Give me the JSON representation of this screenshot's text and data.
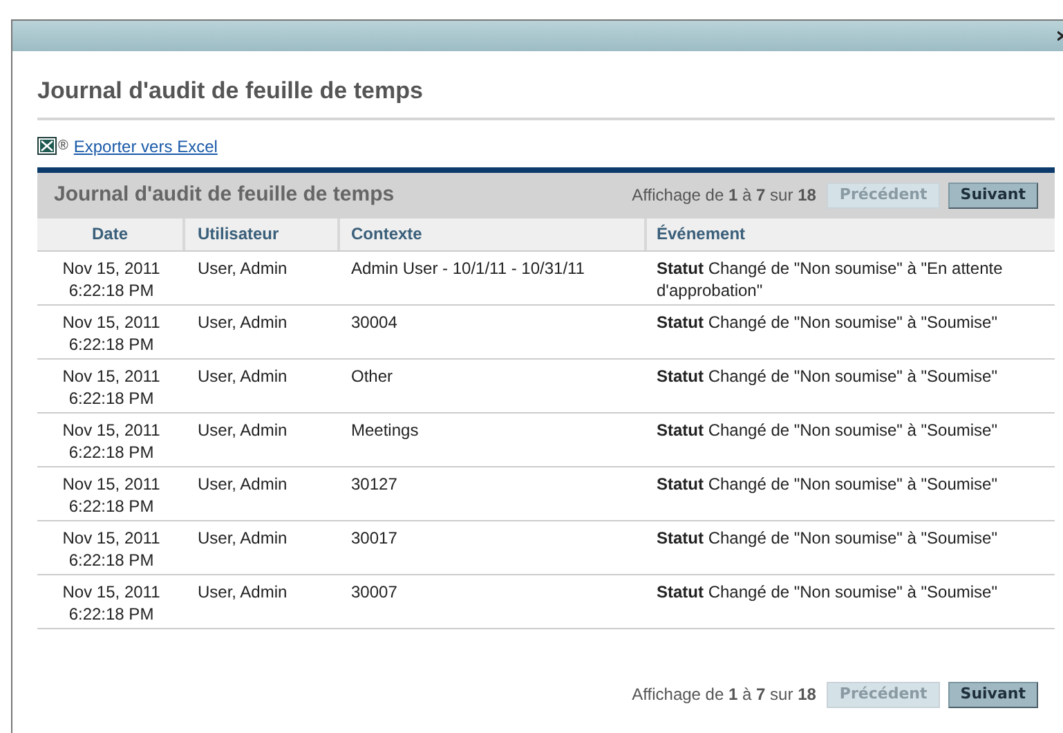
{
  "page": {
    "title": "Journal d'audit de feuille de temps",
    "export_link": "Exporter vers Excel",
    "export_mark": "®"
  },
  "panel": {
    "title": "Journal d'audit de feuille de temps"
  },
  "pagination": [
    {
      "summary": "Affichage de **1** à **7** sur **18**",
      "buttons": [
        {
          "label": "Précédent",
          "disabled": true
        },
        {
          "label": "Suivant",
          "disabled": false
        }
      ]
    },
    {
      "summary": "Affichage de **1** à **7** sur **18**",
      "buttons": [
        {
          "label": "Précédent",
          "disabled": true
        },
        {
          "label": "Suivant",
          "disabled": false
        }
      ]
    }
  ],
  "table": {
    "columns": [
      "Date",
      "Utilisateur",
      "Contexte",
      "Événement"
    ],
    "rows": [
      {
        "date": [
          "Nov 15, 2011",
          "6:22:18 PM"
        ],
        "user": "User, Admin",
        "context": "Admin User - 10/1/11 - 10/31/11",
        "event": "**Statut** Changé de \"Non soumise\" à \"En attente d'approbation\""
      },
      {
        "date": [
          "Nov 15, 2011",
          "6:22:18 PM"
        ],
        "user": "User, Admin",
        "context": "30004",
        "event": "**Statut** Changé de \"Non soumise\" à \"Soumise\""
      },
      {
        "date": [
          "Nov 15, 2011",
          "6:22:18 PM"
        ],
        "user": "User, Admin",
        "context": "Other",
        "event": "**Statut** Changé de \"Non soumise\" à \"Soumise\""
      },
      {
        "date": [
          "Nov 15, 2011",
          "6:22:18 PM"
        ],
        "user": "User, Admin",
        "context": "Meetings",
        "event": "**Statut** Changé de \"Non soumise\" à \"Soumise\""
      },
      {
        "date": [
          "Nov 15, 2011",
          "6:22:18 PM"
        ],
        "user": "User, Admin",
        "context": "30127",
        "event": "**Statut** Changé de \"Non soumise\" à \"Soumise\""
      },
      {
        "date": [
          "Nov 15, 2011",
          "6:22:18 PM"
        ],
        "user": "User, Admin",
        "context": "30017",
        "event": "**Statut** Changé de \"Non soumise\" à \"Soumise\""
      },
      {
        "date": [
          "Nov 15, 2011",
          "6:22:18 PM"
        ],
        "user": "User, Admin",
        "context": "30007",
        "event": "**Statut** Changé de \"Non soumise\" à \"Soumise\""
      }
    ]
  }
}
